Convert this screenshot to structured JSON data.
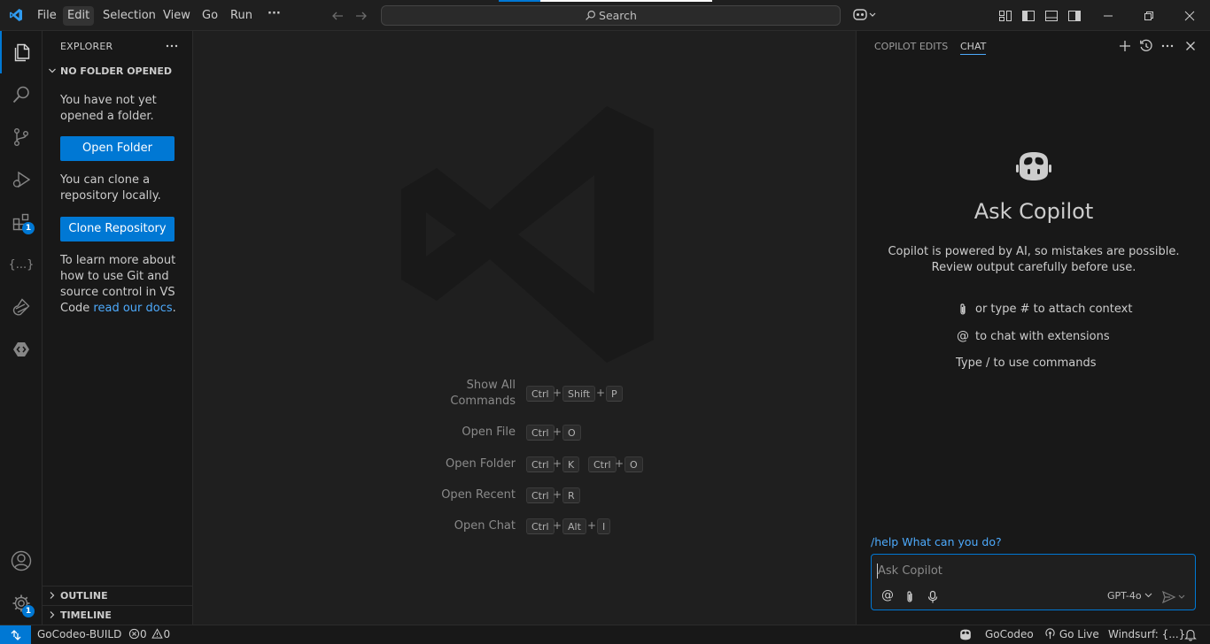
{
  "menu": {
    "items": [
      "File",
      "Edit",
      "Selection",
      "View",
      "Go",
      "Run",
      "···"
    ],
    "active": "Edit"
  },
  "search": {
    "label": "Search"
  },
  "activity": {
    "badges": {
      "extensions": "1",
      "manage": "1"
    },
    "snippets_label": "{...}"
  },
  "sidebar": {
    "title": "EXPLORER",
    "section": "NO FOLDER OPENED",
    "no_folder_text": "You have not yet opened a folder.",
    "open_folder_label": "Open Folder",
    "clone_text": "You can clone a repository locally.",
    "clone_label": "Clone Repository",
    "learn_text": "To learn more about how to use Git and source control in VS Code",
    "learn_link": "read our docs",
    "learn_end": ".",
    "outline": "OUTLINE",
    "timeline": "TIMELINE"
  },
  "editor": {
    "shortcuts": [
      {
        "label_line1": "Show All",
        "label_line2": "Commands",
        "keys": [
          "Ctrl",
          "Shift",
          "P"
        ]
      },
      {
        "label": "Open File",
        "keys": [
          "Ctrl",
          "O"
        ]
      },
      {
        "label": "Open Folder",
        "keys": [
          "Ctrl",
          "K",
          "Ctrl",
          "O"
        ]
      },
      {
        "label": "Open Recent",
        "keys": [
          "Ctrl",
          "R"
        ]
      },
      {
        "label": "Open Chat",
        "keys": [
          "Ctrl",
          "Alt",
          "I"
        ]
      }
    ],
    "plus": "+"
  },
  "chat": {
    "tabs": [
      "COPILOT EDITS",
      "CHAT"
    ],
    "active_tab": "CHAT",
    "title": "Ask Copilot",
    "disclaimer": "Copilot is powered by AI, so mistakes are possible. Review output carefully before use.",
    "hints": {
      "attach": "or type # to attach context",
      "mention_symbol": "@",
      "mention": "to chat with extensions",
      "commands": "Type / to use commands"
    },
    "help_prefix": "/help",
    "help_text": "What can you do?",
    "input_placeholder": "Ask Copilot",
    "input_at": "@",
    "model": "GPT-4o"
  },
  "statusbar": {
    "branch": "GoCodeo-BUILD",
    "errors": "0",
    "warnings": "0",
    "gocodeo": "GoCodeo",
    "golive": "Go Live",
    "windsurf": "Windsurf: {...}"
  },
  "colors": {
    "accent": "#0078d4",
    "link": "#4daafc",
    "background": "#181818",
    "editor_background": "#1f1f1f"
  }
}
